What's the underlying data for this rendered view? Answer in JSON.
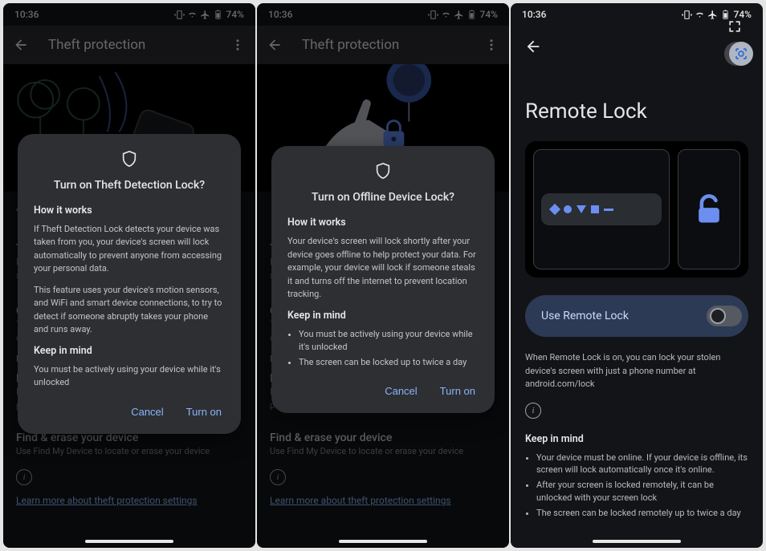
{
  "status": {
    "time": "10:36",
    "battery": "74%",
    "icons": [
      "vibrate",
      "wifi",
      "airplane",
      "battery"
    ]
  },
  "app_bar": {
    "title": "Theft protection"
  },
  "dialog1": {
    "title": "Turn on Theft Detection Lock?",
    "h_how": "How it works",
    "p1": "If Theft Detection Lock detects your device was taken from you, your device's screen will lock automatically to prevent anyone from accessing your personal data.",
    "p2": "This feature uses your device's motion sensors, and WiFi and smart device connections, to try to detect if someone abruptly takes your phone and runs away.",
    "h_keep": "Keep in mind",
    "p3": "You must be actively using your device while it's unlocked",
    "cancel": "Cancel",
    "confirm": "Turn on"
  },
  "dialog2": {
    "title": "Turn on Offline Device Lock?",
    "h_how": "How it works",
    "p1": "Your device's screen will lock shortly after your device goes offline to help protect your data. For example, your device will lock if someone steals it and turns off the internet to prevent location tracking.",
    "h_keep": "Keep in mind",
    "li1": "You must be actively using your device while it's unlocked",
    "li2": "The screen can be locked up to twice a day",
    "cancel": "Cancel",
    "confirm": "Turn on"
  },
  "bg": {
    "find_title": "Find & erase your device",
    "find_sub": "Use Find My Device to locate or erase your device",
    "learn": "Learn more about theft protection settings",
    "remote_title": "R",
    "remote_sub_a": "If",
    "remote_sub_b": "pho",
    "off_a": "O",
    "off_b": "Thi",
    "off_c": "off",
    "t_a": "T",
    "t_b": "If",
    "t_c": "sc",
    "re_a": "Re",
    "au_a": "Au"
  },
  "p3": {
    "title": "Remote Lock",
    "toggle_label": "Use Remote Lock",
    "desc": "When Remote Lock is on, you can lock your stolen device's screen with just a phone number at android.com/lock",
    "h_keep": "Keep in mind",
    "li1": "Your device must be online. If your device is offline, its screen will lock automatically once it's online.",
    "li2": "After your screen is locked remotely, it can be unlocked with your screen lock",
    "li3": "The screen can be locked remotely up to twice a day"
  }
}
